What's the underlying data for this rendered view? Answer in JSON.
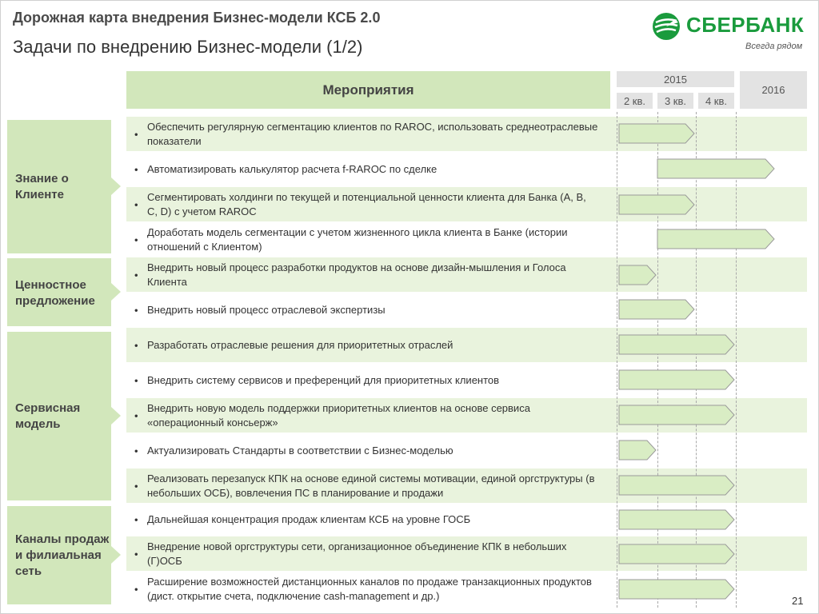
{
  "header": {
    "title": "Дорожная карта внедрения Бизнес-модели КСБ 2.0",
    "subtitle": "Задачи по внедрению Бизнес-модели (1/2)"
  },
  "logo": {
    "name": "СБЕРБАНК",
    "slogan": "Всегда рядом",
    "brand_color": "#1a9b3d"
  },
  "table_header": {
    "activities": "Мероприятия",
    "year1": "2015",
    "quarters": [
      "2 кв.",
      "3 кв.",
      "4 кв."
    ],
    "year2": "2016"
  },
  "categories": [
    {
      "label": "Знание о Клиенте"
    },
    {
      "label": "Ценностное предложение"
    },
    {
      "label": "Сервисная модель"
    },
    {
      "label": "Каналы продаж и филиальная сеть"
    }
  ],
  "tasks": [
    {
      "text": "Обеспечить регулярную сегментацию клиентов по RAROC, использовать среднеотраслевые показатели",
      "start": "2 кв.",
      "end": "3 кв."
    },
    {
      "text": "Автоматизировать калькулятор расчета f-RAROC по сделке",
      "start": "3 кв.",
      "end": "2016"
    },
    {
      "text": "Сегментировать холдинги по текущей и потенциальной ценности клиента для Банка (A, B, C, D) с учетом RAROC",
      "start": "2 кв.",
      "end": "3 кв."
    },
    {
      "text": "Доработать модель сегментации с учетом жизненного цикла клиента в Банке (истории отношений с Клиентом)",
      "start": "3 кв.",
      "end": "2016"
    },
    {
      "text": "Внедрить новый процесс разработки продуктов на основе дизайн-мышления и Голоса Клиента",
      "start": "2 кв.",
      "end": "2 кв."
    },
    {
      "text": "Внедрить новый процесс отраслевой экспертизы",
      "start": "2 кв.",
      "end": "3 кв."
    },
    {
      "text": "Разработать отраслевые решения для приоритетных отраслей",
      "start": "2 кв.",
      "end": "4 кв."
    },
    {
      "text": "Внедрить систему сервисов и преференций для приоритетных клиентов",
      "start": "2 кв.",
      "end": "4 кв."
    },
    {
      "text": "Внедрить новую модель поддержки приоритетных клиентов на основе сервиса «операционный консьерж»",
      "start": "2 кв.",
      "end": "4 кв."
    },
    {
      "text": "Актуализировать Стандарты в соответствии с Бизнес-моделью",
      "start": "2 кв.",
      "end": "2 кв."
    },
    {
      "text": "Реализовать перезапуск КПК на основе единой системы мотивации, единой оргструктуры (в небольших ОСБ), вовлечения ПС в планирование и продажи",
      "start": "2 кв.",
      "end": "4 кв."
    },
    {
      "text": "Дальнейшая концентрация продаж клиентам КСБ на уровне ГОСБ",
      "start": "2 кв.",
      "end": "4 кв."
    },
    {
      "text": "Внедрение новой оргструктуры сети, организационное объединение КПК в небольших (Г)ОСБ",
      "start": "2 кв.",
      "end": "4 кв."
    },
    {
      "text": "Расширение возможностей дистанционных каналов по продаже транзакционных продуктов (дист. открытие счета, подключение cash-management и др.)",
      "start": "2 кв.",
      "end": "4 кв."
    }
  ],
  "colors": {
    "bar_fill": "#d9edc4",
    "bar_stroke": "#9a9a9a",
    "category_fill": "#d2e7bb",
    "row_shade": "#e9f3dd"
  },
  "page_number": "21"
}
